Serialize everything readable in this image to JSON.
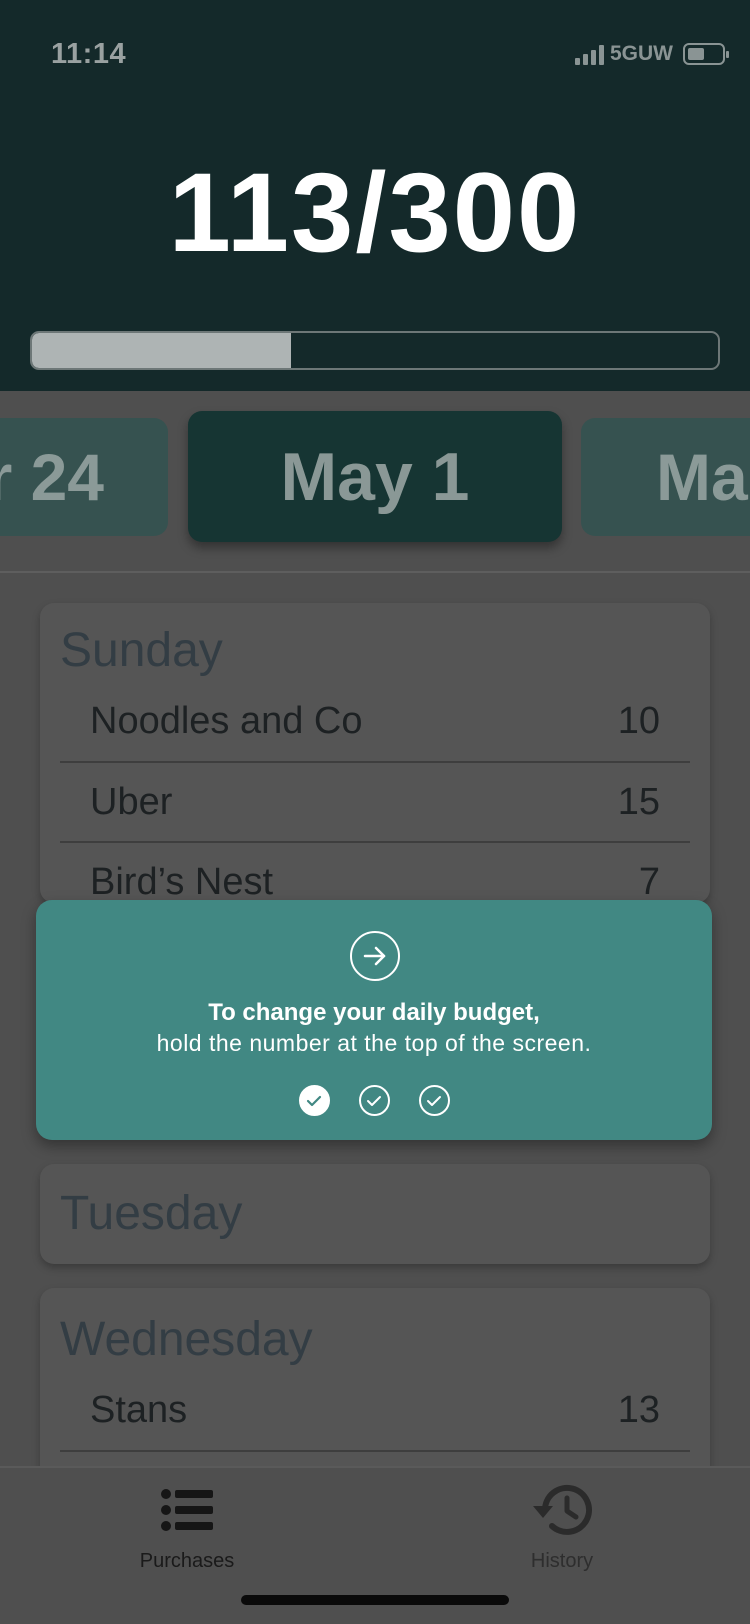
{
  "status_bar": {
    "time": "11:14",
    "network": "5GUW"
  },
  "header": {
    "budget_text": "113/300",
    "spent": 113,
    "budget": 300,
    "progress_fraction": 0.377
  },
  "date_strip": {
    "prev_label": "r 24",
    "current_label": "May 1",
    "next_label": "Ma"
  },
  "days": [
    {
      "name": "Sunday",
      "purchases": [
        {
          "name": "Noodles and Co",
          "amount": "10"
        },
        {
          "name": "Uber",
          "amount": "15"
        },
        {
          "name": "Bird’s Nest",
          "amount": "7"
        }
      ]
    },
    {
      "name": "Tuesday",
      "purchases": []
    },
    {
      "name": "Wednesday",
      "purchases": [
        {
          "name": "Stans",
          "amount": "13"
        }
      ]
    }
  ],
  "tip": {
    "line1": "To change your daily budget,",
    "line2": "hold the number at the top of the screen.",
    "steps": [
      "done",
      "pending",
      "pending"
    ]
  },
  "tabs": {
    "purchases_label": "Purchases",
    "history_label": "History"
  },
  "colors": {
    "header_bg": "#14292a",
    "tip_bg": "#418883",
    "overlay_bg": "#4f4f4f"
  }
}
